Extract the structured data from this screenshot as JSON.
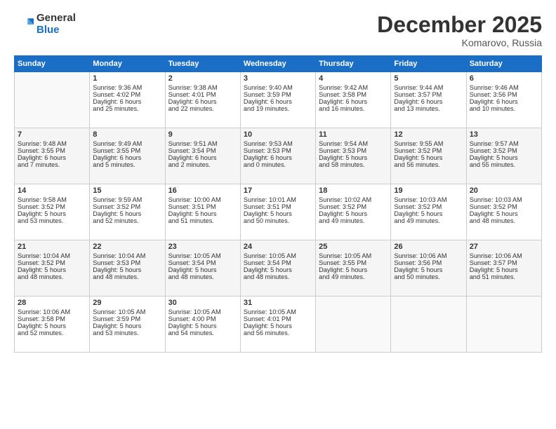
{
  "logo": {
    "general": "General",
    "blue": "Blue"
  },
  "title": "December 2025",
  "location": "Komarovo, Russia",
  "headers": [
    "Sunday",
    "Monday",
    "Tuesday",
    "Wednesday",
    "Thursday",
    "Friday",
    "Saturday"
  ],
  "weeks": [
    [
      {
        "day": "",
        "info": ""
      },
      {
        "day": "1",
        "info": "Sunrise: 9:36 AM\nSunset: 4:02 PM\nDaylight: 6 hours\nand 25 minutes."
      },
      {
        "day": "2",
        "info": "Sunrise: 9:38 AM\nSunset: 4:01 PM\nDaylight: 6 hours\nand 22 minutes."
      },
      {
        "day": "3",
        "info": "Sunrise: 9:40 AM\nSunset: 3:59 PM\nDaylight: 6 hours\nand 19 minutes."
      },
      {
        "day": "4",
        "info": "Sunrise: 9:42 AM\nSunset: 3:58 PM\nDaylight: 6 hours\nand 16 minutes."
      },
      {
        "day": "5",
        "info": "Sunrise: 9:44 AM\nSunset: 3:57 PM\nDaylight: 6 hours\nand 13 minutes."
      },
      {
        "day": "6",
        "info": "Sunrise: 9:46 AM\nSunset: 3:56 PM\nDaylight: 6 hours\nand 10 minutes."
      }
    ],
    [
      {
        "day": "7",
        "info": "Sunrise: 9:48 AM\nSunset: 3:55 PM\nDaylight: 6 hours\nand 7 minutes."
      },
      {
        "day": "8",
        "info": "Sunrise: 9:49 AM\nSunset: 3:55 PM\nDaylight: 6 hours\nand 5 minutes."
      },
      {
        "day": "9",
        "info": "Sunrise: 9:51 AM\nSunset: 3:54 PM\nDaylight: 6 hours\nand 2 minutes."
      },
      {
        "day": "10",
        "info": "Sunrise: 9:53 AM\nSunset: 3:53 PM\nDaylight: 6 hours\nand 0 minutes."
      },
      {
        "day": "11",
        "info": "Sunrise: 9:54 AM\nSunset: 3:53 PM\nDaylight: 5 hours\nand 58 minutes."
      },
      {
        "day": "12",
        "info": "Sunrise: 9:55 AM\nSunset: 3:52 PM\nDaylight: 5 hours\nand 56 minutes."
      },
      {
        "day": "13",
        "info": "Sunrise: 9:57 AM\nSunset: 3:52 PM\nDaylight: 5 hours\nand 55 minutes."
      }
    ],
    [
      {
        "day": "14",
        "info": "Sunrise: 9:58 AM\nSunset: 3:52 PM\nDaylight: 5 hours\nand 53 minutes."
      },
      {
        "day": "15",
        "info": "Sunrise: 9:59 AM\nSunset: 3:52 PM\nDaylight: 5 hours\nand 52 minutes."
      },
      {
        "day": "16",
        "info": "Sunrise: 10:00 AM\nSunset: 3:51 PM\nDaylight: 5 hours\nand 51 minutes."
      },
      {
        "day": "17",
        "info": "Sunrise: 10:01 AM\nSunset: 3:51 PM\nDaylight: 5 hours\nand 50 minutes."
      },
      {
        "day": "18",
        "info": "Sunrise: 10:02 AM\nSunset: 3:52 PM\nDaylight: 5 hours\nand 49 minutes."
      },
      {
        "day": "19",
        "info": "Sunrise: 10:03 AM\nSunset: 3:52 PM\nDaylight: 5 hours\nand 49 minutes."
      },
      {
        "day": "20",
        "info": "Sunrise: 10:03 AM\nSunset: 3:52 PM\nDaylight: 5 hours\nand 48 minutes."
      }
    ],
    [
      {
        "day": "21",
        "info": "Sunrise: 10:04 AM\nSunset: 3:52 PM\nDaylight: 5 hours\nand 48 minutes."
      },
      {
        "day": "22",
        "info": "Sunrise: 10:04 AM\nSunset: 3:53 PM\nDaylight: 5 hours\nand 48 minutes."
      },
      {
        "day": "23",
        "info": "Sunrise: 10:05 AM\nSunset: 3:54 PM\nDaylight: 5 hours\nand 48 minutes."
      },
      {
        "day": "24",
        "info": "Sunrise: 10:05 AM\nSunset: 3:54 PM\nDaylight: 5 hours\nand 48 minutes."
      },
      {
        "day": "25",
        "info": "Sunrise: 10:05 AM\nSunset: 3:55 PM\nDaylight: 5 hours\nand 49 minutes."
      },
      {
        "day": "26",
        "info": "Sunrise: 10:06 AM\nSunset: 3:56 PM\nDaylight: 5 hours\nand 50 minutes."
      },
      {
        "day": "27",
        "info": "Sunrise: 10:06 AM\nSunset: 3:57 PM\nDaylight: 5 hours\nand 51 minutes."
      }
    ],
    [
      {
        "day": "28",
        "info": "Sunrise: 10:06 AM\nSunset: 3:58 PM\nDaylight: 5 hours\nand 52 minutes."
      },
      {
        "day": "29",
        "info": "Sunrise: 10:05 AM\nSunset: 3:59 PM\nDaylight: 5 hours\nand 53 minutes."
      },
      {
        "day": "30",
        "info": "Sunrise: 10:05 AM\nSunset: 4:00 PM\nDaylight: 5 hours\nand 54 minutes."
      },
      {
        "day": "31",
        "info": "Sunrise: 10:05 AM\nSunset: 4:01 PM\nDaylight: 5 hours\nand 56 minutes."
      },
      {
        "day": "",
        "info": ""
      },
      {
        "day": "",
        "info": ""
      },
      {
        "day": "",
        "info": ""
      }
    ]
  ]
}
